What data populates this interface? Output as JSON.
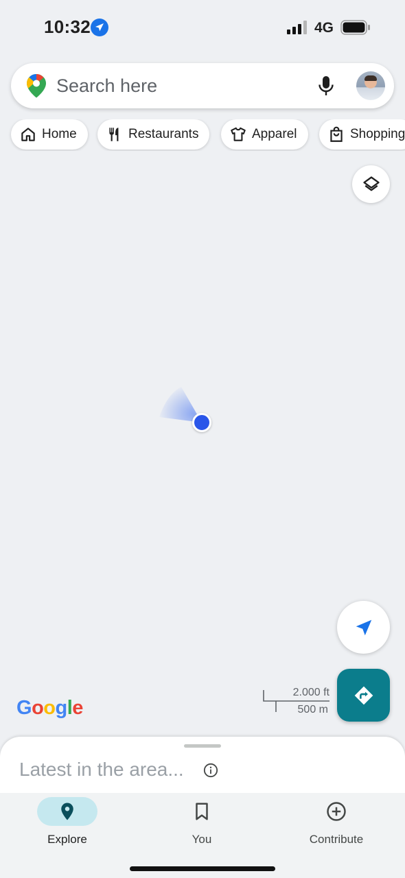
{
  "status_bar": {
    "time": "10:32",
    "network": "4G",
    "icons": [
      "location-arrow-icon",
      "signal-icon",
      "battery-icon"
    ]
  },
  "search": {
    "placeholder": "Search here",
    "icons": [
      "google-maps-logo-icon",
      "mic-icon",
      "avatar"
    ]
  },
  "chips": [
    {
      "label": "Home",
      "icon": "home-icon"
    },
    {
      "label": "Restaurants",
      "icon": "restaurant-icon"
    },
    {
      "label": "Apparel",
      "icon": "shirt-icon"
    },
    {
      "label": "Shopping",
      "icon": "shopping-bag-icon"
    }
  ],
  "map": {
    "google_logo": "Google",
    "scale_imperial": "2.000 ft",
    "scale_metric": "500 m",
    "colors": {
      "background": "#eef0f3",
      "user_dot": "#2a56e9",
      "directions": "#0b7d8c"
    }
  },
  "sheet": {
    "title": "Latest in the area..."
  },
  "nav": {
    "items": [
      {
        "label": "Explore",
        "icon": "location-pin-icon",
        "active": true
      },
      {
        "label": "You",
        "icon": "bookmark-icon",
        "active": false
      },
      {
        "label": "Contribute",
        "icon": "add-circle-icon",
        "active": false
      }
    ]
  }
}
